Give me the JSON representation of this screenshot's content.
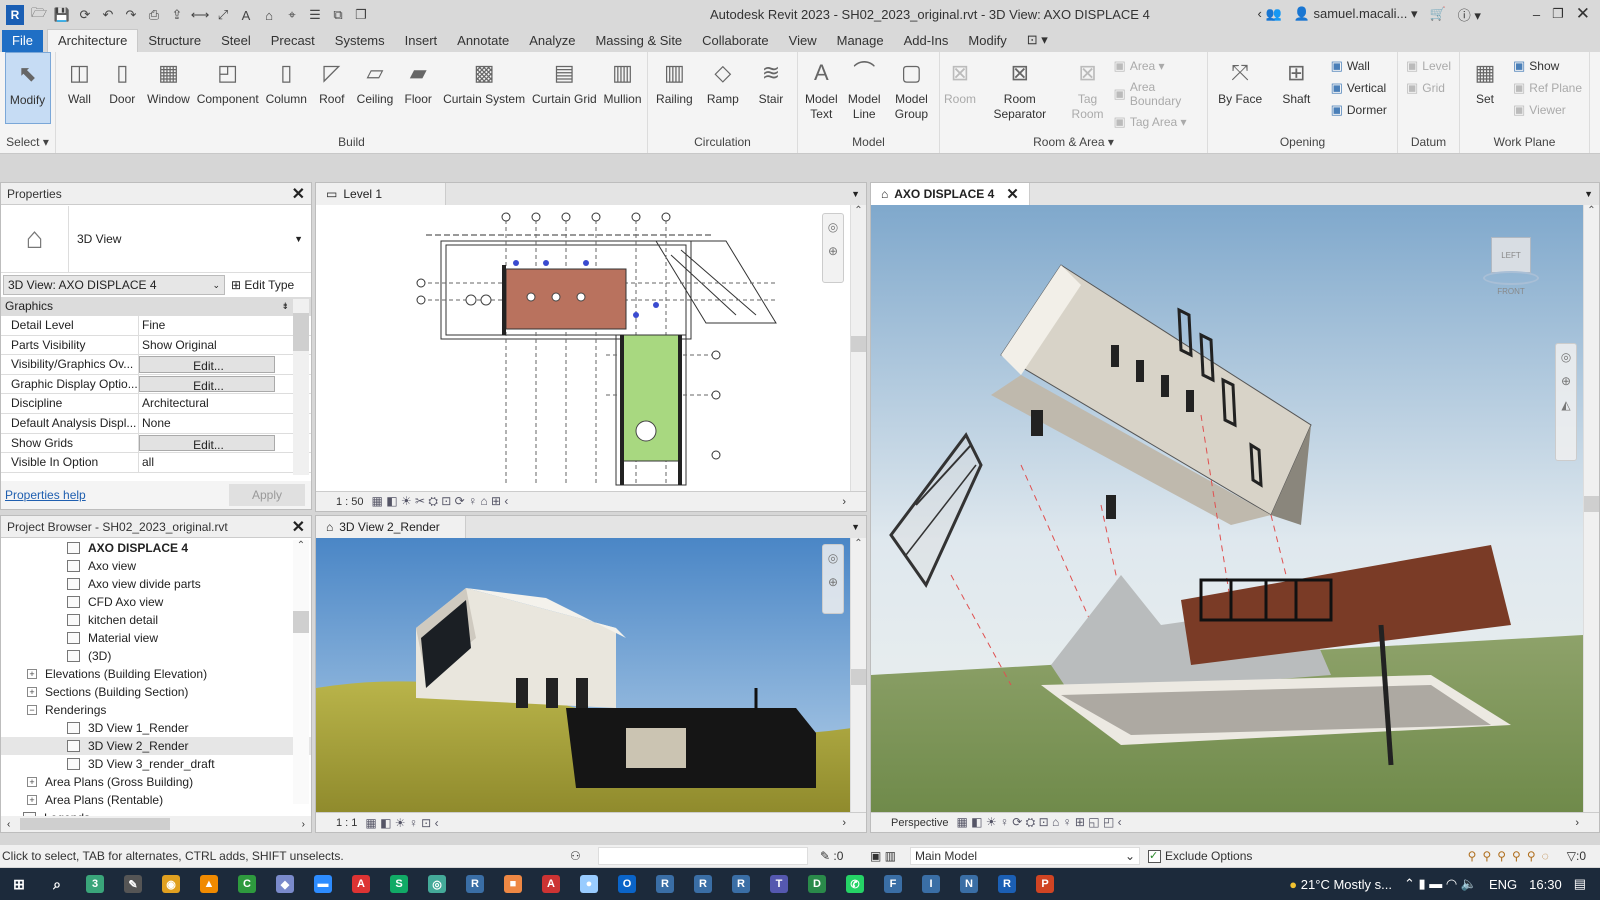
{
  "window": {
    "title": "Autodesk Revit 2023 - SH02_2023_original.rvt - 3D View: AXO DISPLACE 4",
    "user": "samuel.macali...",
    "app_logo": "R",
    "quick_access": [
      "open-icon",
      "save-icon",
      "sync-icon",
      "undo-icon",
      "redo-icon",
      "print-icon",
      "export-icon",
      "measure-icon",
      "dimension-icon",
      "text-icon",
      "3d-view-icon",
      "section-icon",
      "thin-lines-icon",
      "close-hidden-icon",
      "switch-windows-icon"
    ]
  },
  "tabs": [
    "File",
    "Architecture",
    "Structure",
    "Steel",
    "Precast",
    "Systems",
    "Insert",
    "Annotate",
    "Analyze",
    "Massing & Site",
    "Collaborate",
    "View",
    "Manage",
    "Add-Ins",
    "Modify"
  ],
  "active_tab": "Architecture",
  "ribbon": {
    "select": {
      "label": "Select ▾",
      "button": "Modify"
    },
    "build": {
      "label": "Build",
      "buttons": [
        "Wall",
        "Door",
        "Window",
        "Component",
        "Column",
        "Roof",
        "Ceiling",
        "Floor",
        "Curtain System",
        "Curtain Grid",
        "Mullion"
      ]
    },
    "circulation": {
      "label": "Circulation",
      "buttons": [
        "Railing",
        "Ramp",
        "Stair"
      ]
    },
    "model": {
      "label": "Model",
      "buttons": [
        "Model Text",
        "Model Line",
        "Model Group"
      ]
    },
    "room_area": {
      "label": "Room & Area ▾",
      "buttons": [
        "Room",
        "Room Separator",
        "Tag Room"
      ],
      "small": [
        "Area ▾",
        "Area Boundary",
        "Tag Area ▾"
      ]
    },
    "opening": {
      "label": "Opening",
      "buttons": [
        "By Face",
        "Shaft"
      ],
      "small": [
        "Wall",
        "Vertical",
        "Dormer"
      ]
    },
    "datum": {
      "label": "Datum",
      "small": [
        "Level",
        "Grid"
      ]
    },
    "work_plane": {
      "label": "Work Plane",
      "buttons": [
        "Set"
      ],
      "small": [
        "Show",
        "Ref Plane",
        "Viewer"
      ]
    }
  },
  "properties": {
    "title": "Properties",
    "type_name": "3D View",
    "instance": "3D View: AXO DISPLACE 4",
    "edit_type": "Edit Type",
    "group": "Graphics",
    "rows": [
      {
        "k": "Detail Level",
        "v": "Fine"
      },
      {
        "k": "Parts Visibility",
        "v": "Show Original"
      },
      {
        "k": "Visibility/Graphics Ov...",
        "v": "Edit...",
        "btn": true
      },
      {
        "k": "Graphic Display Optio...",
        "v": "Edit...",
        "btn": true
      },
      {
        "k": "Discipline",
        "v": "Architectural"
      },
      {
        "k": "Default Analysis Displ...",
        "v": "None"
      },
      {
        "k": "Show Grids",
        "v": "Edit...",
        "btn": true
      },
      {
        "k": "Visible In Option",
        "v": "all"
      }
    ],
    "help": "Properties help",
    "apply": "Apply"
  },
  "browser": {
    "title": "Project Browser - SH02_2023_original.rvt",
    "items": [
      {
        "t": "AXO DISPLACE 4",
        "lvl": 2,
        "bold": true
      },
      {
        "t": "Axo view",
        "lvl": 2
      },
      {
        "t": "Axo view divide parts",
        "lvl": 2
      },
      {
        "t": "CFD Axo view",
        "lvl": 2
      },
      {
        "t": "kitchen detail",
        "lvl": 2
      },
      {
        "t": "Material view",
        "lvl": 2
      },
      {
        "t": "(3D)",
        "lvl": 2
      },
      {
        "t": "Elevations (Building Elevation)",
        "lvl": 1,
        "pm": "+"
      },
      {
        "t": "Sections (Building Section)",
        "lvl": 1,
        "pm": "+"
      },
      {
        "t": "Renderings",
        "lvl": 1,
        "pm": "−"
      },
      {
        "t": "3D View 1_Render",
        "lvl": 2
      },
      {
        "t": "3D View 2_Render",
        "lvl": 2,
        "hl": true
      },
      {
        "t": "3D View 3_render_draft",
        "lvl": 2
      },
      {
        "t": "Area Plans (Gross Building)",
        "lvl": 1,
        "pm": "+"
      },
      {
        "t": "Area Plans (Rentable)",
        "lvl": 1,
        "pm": "+"
      },
      {
        "t": "Legends",
        "lvl": 0
      }
    ]
  },
  "views": {
    "plan": {
      "tab": "Level 1",
      "scale": "1 : 50"
    },
    "render": {
      "tab": "3D View 2_Render",
      "scale": "1 : 1"
    },
    "axo": {
      "tab": "AXO DISPLACE 4",
      "mode": "Perspective",
      "viewcube": "LEFT  FRONT"
    }
  },
  "status": {
    "hint": "Click to select, TAB for alternates, CTRL adds, SHIFT unselects.",
    "worksets": ":0",
    "model": "Main Model",
    "exclude_options": "Exclude Options",
    "exclude_checked": true,
    "filter": ":0"
  },
  "taskbar": {
    "apps": [
      {
        "i": "3",
        "c": "#3aa57a"
      },
      {
        "i": "✎",
        "c": "#555"
      },
      {
        "i": "◉",
        "c": "#e0a020"
      },
      {
        "i": "▲",
        "c": "#f08a00"
      },
      {
        "i": "C",
        "c": "#2e9a3e"
      },
      {
        "i": "◆",
        "c": "#7a8acb"
      },
      {
        "i": "▬",
        "c": "#2d8cff"
      },
      {
        "i": "A",
        "c": "#d33"
      },
      {
        "i": "S",
        "c": "#1a6"
      },
      {
        "i": "◎",
        "c": "#4a9"
      },
      {
        "i": "R",
        "c": "#3a6ea5"
      },
      {
        "i": "■",
        "c": "#e84"
      },
      {
        "i": "A",
        "c": "#c33"
      },
      {
        "i": "●",
        "c": "#9cf"
      },
      {
        "i": "O",
        "c": "#0a64c8"
      },
      {
        "i": "R",
        "c": "#3a6ea5"
      },
      {
        "i": "R",
        "c": "#3a6ea5"
      },
      {
        "i": "R",
        "c": "#3a6ea5"
      },
      {
        "i": "T",
        "c": "#5558af"
      },
      {
        "i": "D",
        "c": "#2a8a4a"
      },
      {
        "i": "✆",
        "c": "#25d366"
      },
      {
        "i": "F",
        "c": "#3a6ea5"
      },
      {
        "i": "I",
        "c": "#3a6ea5"
      },
      {
        "i": "N",
        "c": "#3a6ea5"
      },
      {
        "i": "R",
        "c": "#1b5fb4"
      },
      {
        "i": "P",
        "c": "#d04423"
      }
    ],
    "weather": "21°C  Mostly s...",
    "lang": "ENG",
    "time": "16:30"
  },
  "colors": {
    "accent": "#1f6fc5",
    "plan_room": "#b9725e",
    "plan_green": "#a8d880"
  }
}
